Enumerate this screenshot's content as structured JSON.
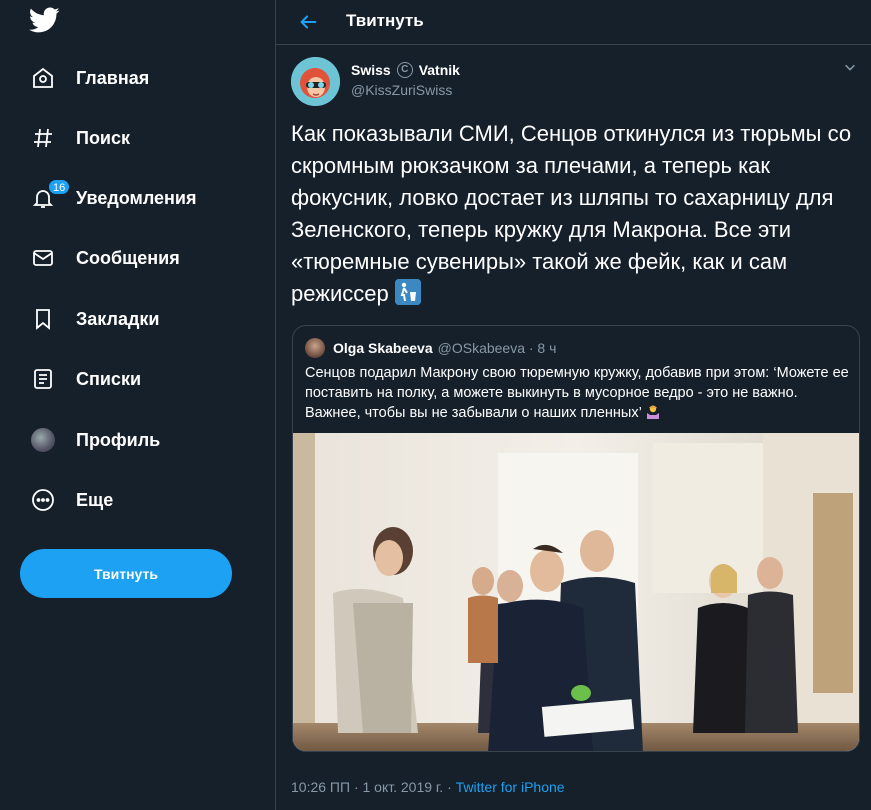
{
  "sidebar": {
    "logo": "twitter-bird-icon",
    "items": [
      {
        "label": "Главная",
        "icon": "home-icon"
      },
      {
        "label": "Поиск",
        "icon": "hashtag-icon"
      },
      {
        "label": "Уведомления",
        "icon": "bell-icon",
        "badge": "16"
      },
      {
        "label": "Сообщения",
        "icon": "envelope-icon"
      },
      {
        "label": "Закладки",
        "icon": "bookmark-icon"
      },
      {
        "label": "Списки",
        "icon": "list-icon"
      },
      {
        "label": "Профиль",
        "icon": "avatar"
      },
      {
        "label": "Еще",
        "icon": "more-icon"
      }
    ],
    "tweet_button": "Твитнуть"
  },
  "header": {
    "title": "Твитнуть",
    "back_icon": "back-arrow-icon"
  },
  "tweet": {
    "author_name_1": "Swiss",
    "author_mark": "C",
    "author_name_2": "Vatnik",
    "author_handle": "@KissZuriSwiss",
    "text": "Как показывали СМИ, Сенцов откинулся из тюрьмы со скромным рюкзачком за плечами, а теперь как фокусник, ловко достает из шляпы то сахарницу для Зеленского, теперь кружку для Макрона. Все эти «тюремные сувениры» такой же фейк, как и сам режиссер",
    "emoji": "put-litter-in-its-place-icon",
    "time": "10:26 ПП · 1 окт. 2019 г. · ",
    "source": "Twitter for iPhone"
  },
  "quote": {
    "name": "Olga Skabeeva",
    "handle": "@OSkabeeva · 8 ч",
    "text": "Сенцов подарил Макрону свою тюремную кружку, добавив при этом: ‘Можете ее поставить на полку, а можете выкинуть в мусорное ведро - это не важно. Важнее, чтобы вы не забывали о наших пленных’",
    "emoji": "woman-shrugging-icon"
  },
  "colors": {
    "background": "#15202b",
    "border": "#38444d",
    "accent": "#1da1f2",
    "secondary_text": "#8899a6"
  }
}
